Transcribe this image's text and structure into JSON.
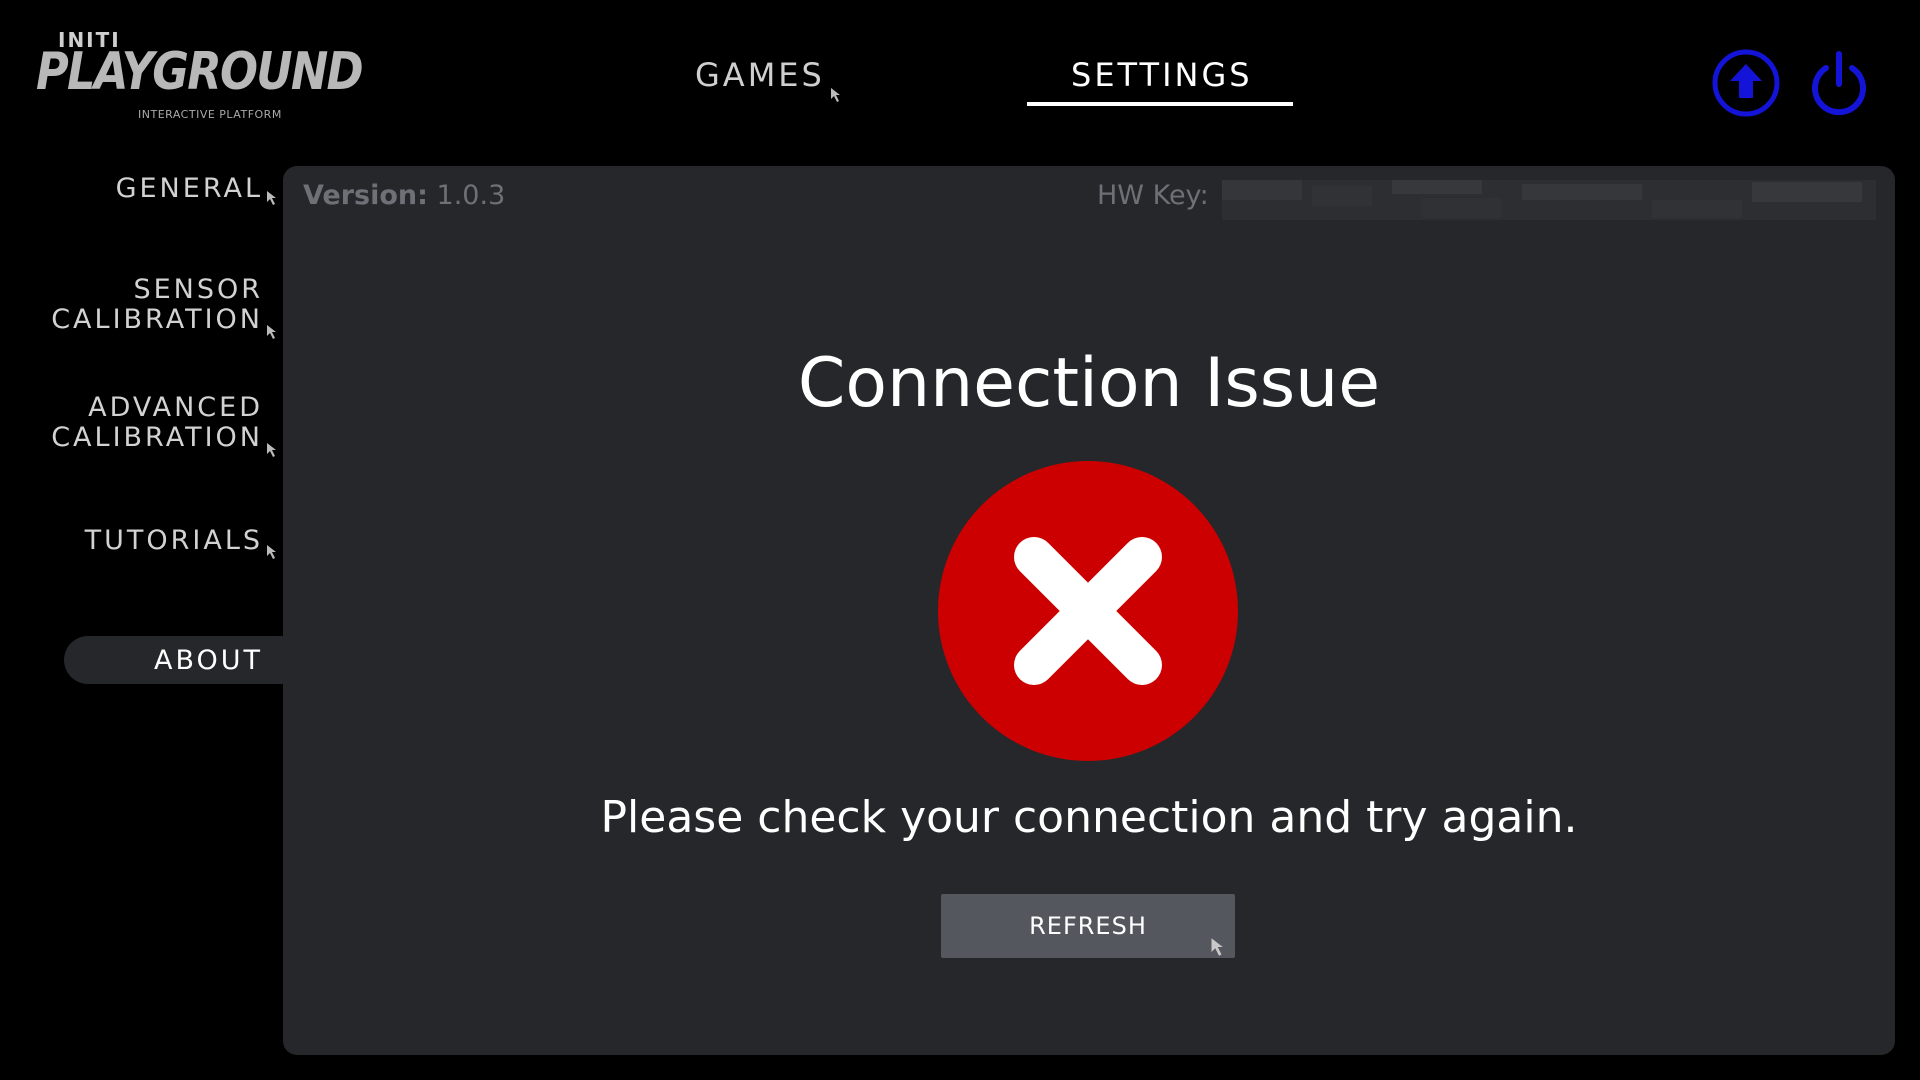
{
  "logo": {
    "top_text": "INITI",
    "main_text": "PLAYGROUND",
    "sub_text": "INTERACTIVE PLATFORM"
  },
  "nav": {
    "tabs": [
      {
        "label": "GAMES",
        "active": false
      },
      {
        "label": "SETTINGS",
        "active": true
      }
    ]
  },
  "top_icons": {
    "upload": "upload-icon",
    "power": "power-icon",
    "color": "#1414d8"
  },
  "sidebar": {
    "items": [
      {
        "label": "GENERAL",
        "active": false
      },
      {
        "label": "SENSOR\nCALIBRATION",
        "active": false
      },
      {
        "label": "ADVANCED\nCALIBRATION",
        "active": false
      },
      {
        "label": "TUTORIALS",
        "active": false
      },
      {
        "label": "ABOUT",
        "active": true
      }
    ]
  },
  "panel": {
    "version_label": "Version:",
    "version_value": "1.0.3",
    "hw_key_label": "HW Key:",
    "background_color": "#25272b"
  },
  "dialog": {
    "title": "Connection Issue",
    "icon": "error-x-icon",
    "icon_color": "#cc0000",
    "message": "Please check your connection and try again.",
    "button_label": "REFRESH"
  }
}
